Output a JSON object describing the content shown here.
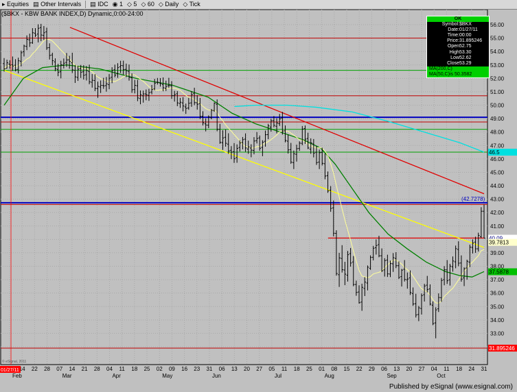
{
  "toolbar": {
    "items": [
      "Equities",
      "Other Intervals",
      "IDC",
      "1",
      "5",
      "60",
      "Daily",
      "Tick"
    ]
  },
  "title": "($BKX - KBW BANK INDEX,D) Dynamic,0:00-24:00",
  "indicator_labels": [
    {
      "text": "MA(200,C)",
      "color": "#00e0e0"
    },
    {
      "text": "MA(50,C)",
      "color": "#008000"
    },
    {
      "text": "MA(10,C)",
      "color": "#ffff80"
    }
  ],
  "legend": {
    "header": "OK",
    "rows": [
      {
        "k": "Symbol:",
        "v": "$BKX"
      },
      {
        "k": "Date:",
        "v": "01/27/11"
      },
      {
        "k": "Time:",
        "v": "00:00"
      },
      {
        "k": "Price:",
        "v": "31.895246"
      },
      {
        "k": "Open",
        "v": "52.75"
      },
      {
        "k": "High",
        "v": "53.30"
      },
      {
        "k": "Low",
        "v": "52.62"
      },
      {
        "k": "Close",
        "v": "53.29"
      }
    ],
    "ma_rows": [
      "MA(200,C)",
      "MA(50,C)is 50.3582"
    ]
  },
  "copyright": "© eSignal, 2011",
  "footer": "Published by eSignal (www.esignal.com)",
  "colors": {
    "background": "#c0c0c0",
    "candle": "#000000",
    "ma10": "#ffff99",
    "ma50": "#008000",
    "ma200": "#00e0e0",
    "trend_red": "#e00000",
    "trend_yellow": "#ffff00",
    "hline_blue": "#0000c0",
    "hline_green": "#00a000",
    "hline_red": "#c00000"
  },
  "chart_data": {
    "type": "candlestick",
    "ylim": [
      31.3,
      56.3
    ],
    "y_ticks": [
      "32.00",
      "33.00",
      "34.00",
      "35.00",
      "36.00",
      "37.00",
      "38.00",
      "39.00",
      "40.00",
      "41.00",
      "42.00",
      "43.00",
      "44.00",
      "45.00",
      "46.00",
      "47.00",
      "48.00",
      "49.00",
      "50.00",
      "51.00",
      "52.00",
      "53.00",
      "54.00",
      "55.00",
      "56.00"
    ],
    "x_tick_labels": [
      "07",
      "14",
      "22",
      "28",
      "07",
      "14",
      "21",
      "28",
      "04",
      "11",
      "18",
      "25",
      "02",
      "09",
      "16",
      "23",
      "31",
      "06",
      "13",
      "20",
      "27",
      "05",
      "11",
      "18",
      "25",
      "01",
      "08",
      "15",
      "22",
      "29",
      "06",
      "13",
      "20",
      "27",
      "04",
      "11",
      "18",
      "24",
      "31"
    ],
    "month_labels": [
      "Feb",
      "Mar",
      "Apr",
      "May",
      "Jun",
      "Jul",
      "Aug",
      "Sep",
      "Oct"
    ],
    "axis_box_labels": [
      {
        "text": "40.09",
        "value": 40.09,
        "bg": "#ffffff",
        "fg": "#000080"
      },
      {
        "text": "39.7813",
        "value": 39.78,
        "bg": "#ffffcc",
        "fg": "#000000"
      },
      {
        "text": "37.5878",
        "value": 37.59,
        "bg": "#00c000",
        "fg": "#000000"
      },
      {
        "text": "46.5",
        "value": 46.5,
        "bg": "#00e0e0",
        "fg": "#000000"
      },
      {
        "text": "31.895246",
        "value": 31.9,
        "bg": "#ff0000",
        "fg": "#ffffff"
      }
    ],
    "annotation": "(42.7278)",
    "annotation_value": 42.73,
    "date_box": "01/27/11",
    "horizontal_lines": [
      {
        "value": 55.0,
        "color": "hline_red"
      },
      {
        "value": 52.6,
        "color": "hline_green"
      },
      {
        "value": 50.7,
        "color": "hline_red"
      },
      {
        "value": 49.1,
        "color": "hline_blue"
      },
      {
        "value": 48.75,
        "color": "hline_red"
      },
      {
        "value": 48.2,
        "color": "hline_green"
      },
      {
        "value": 46.5,
        "color": "hline_green"
      },
      {
        "value": 42.73,
        "color": "hline_blue"
      },
      {
        "value": 42.6,
        "color": "hline_red"
      },
      {
        "value": 31.9,
        "color": "hline_red"
      }
    ],
    "red_segment": {
      "y_from": 40.1,
      "y_to": 40.1,
      "x_from": 135,
      "x_to": 200
    },
    "trend_red": {
      "x_from": 16,
      "y_from": 55.8,
      "x_to": 200,
      "y_to": 43.4
    },
    "trend_yellow": {
      "x_from": 0,
      "y_from": 52.6,
      "x_to": 200,
      "y_to": 39.4
    },
    "ma200": [
      [
        96,
        49.9
      ],
      [
        105,
        50.0
      ],
      [
        118,
        50.0
      ],
      [
        130,
        49.85
      ],
      [
        145,
        49.5
      ],
      [
        160,
        48.8
      ],
      [
        175,
        48.0
      ],
      [
        190,
        47.2
      ],
      [
        200,
        46.5
      ]
    ],
    "ma50": [
      [
        0,
        50.0
      ],
      [
        8,
        52.0
      ],
      [
        16,
        52.8
      ],
      [
        26,
        53.0
      ],
      [
        40,
        52.7
      ],
      [
        55,
        52.0
      ],
      [
        70,
        51.5
      ],
      [
        85,
        50.6
      ],
      [
        95,
        49.4
      ],
      [
        105,
        48.6
      ],
      [
        115,
        48.0
      ],
      [
        125,
        47.4
      ],
      [
        132,
        46.8
      ],
      [
        138,
        45.6
      ],
      [
        145,
        43.8
      ],
      [
        152,
        42.0
      ],
      [
        160,
        40.4
      ],
      [
        168,
        39.3
      ],
      [
        176,
        38.3
      ],
      [
        184,
        37.6
      ],
      [
        190,
        37.3
      ],
      [
        195,
        37.2
      ],
      [
        200,
        37.6
      ]
    ],
    "ohlc": [
      [
        53.1,
        53.51,
        52.51,
        52.71
      ],
      [
        52.75,
        53.39,
        52.73,
        53.16
      ],
      [
        53.06,
        53.35,
        52.72,
        52.98
      ],
      [
        53.0,
        53.63,
        52.56,
        52.92
      ],
      [
        52.98,
        53.43,
        52.52,
        52.64
      ],
      [
        52.67,
        53.54,
        52.37,
        53.31
      ],
      [
        53.28,
        54.07,
        52.89,
        53.91
      ],
      [
        53.98,
        54.51,
        53.63,
        54.41
      ],
      [
        54.38,
        55.2,
        54.1,
        54.9
      ],
      [
        54.87,
        55.33,
        54.34,
        54.64
      ],
      [
        54.66,
        55.74,
        54.57,
        55.4
      ],
      [
        55.36,
        55.74,
        55.08,
        55.22
      ],
      [
        55.3,
        56.03,
        54.68,
        55.73
      ],
      [
        55.78,
        56.06,
        54.77,
        55.23
      ],
      [
        55.2,
        55.9,
        54.85,
        55.4
      ],
      [
        55.47,
        55.78,
        54.12,
        54.27
      ],
      [
        54.29,
        54.61,
        53.4,
        53.71
      ],
      [
        53.74,
        53.91,
        52.97,
        53.32
      ],
      [
        53.23,
        53.49,
        52.53,
        52.72
      ],
      [
        52.67,
        53.08,
        52.16,
        52.46
      ],
      [
        52.49,
        53.31,
        52.0,
        53.01
      ],
      [
        52.98,
        53.48,
        52.74,
        53.13
      ],
      [
        53.19,
        53.89,
        52.86,
        53.37
      ],
      [
        53.38,
        53.68,
        52.72,
        53.27
      ],
      [
        53.16,
        53.91,
        52.4,
        52.63
      ],
      [
        52.6,
        53.0,
        51.66,
        52.11
      ],
      [
        52.07,
        52.93,
        51.81,
        52.68
      ],
      [
        52.74,
        53.0,
        52.03,
        52.46
      ],
      [
        52.49,
        52.98,
        51.91,
        52.23
      ],
      [
        52.27,
        52.92,
        51.84,
        52.58
      ],
      [
        52.51,
        53.02,
        51.56,
        51.74
      ],
      [
        51.71,
        52.32,
        51.31,
        51.86
      ],
      [
        51.84,
        52.31,
        51.05,
        51.25
      ],
      [
        51.24,
        51.76,
        50.55,
        51.4
      ],
      [
        51.36,
        51.84,
        50.91,
        51.48
      ],
      [
        51.47,
        52.04,
        51.22,
        51.44
      ],
      [
        51.46,
        52.1,
        51.01,
        51.59
      ],
      [
        51.53,
        52.32,
        51.19,
        52.01
      ],
      [
        52.08,
        52.83,
        51.64,
        52.58
      ],
      [
        52.64,
        53.02,
        52.08,
        52.24
      ],
      [
        52.34,
        53.13,
        52.04,
        52.8
      ],
      [
        52.86,
        53.31,
        52.4,
        52.96
      ],
      [
        52.94,
        53.32,
        52.28,
        52.65
      ],
      [
        52.67,
        53.1,
        52.09,
        52.57
      ],
      [
        52.52,
        53.03,
        51.83,
        52.08
      ],
      [
        52.05,
        52.37,
        50.92,
        51.15
      ],
      [
        51.17,
        51.88,
        50.88,
        51.48
      ],
      [
        51.45,
        51.89,
        50.3,
        50.54
      ],
      [
        50.5,
        51.1,
        50.07,
        50.78
      ],
      [
        50.7,
        51.09,
        50.19,
        50.84
      ],
      [
        50.84,
        51.17,
        50.37,
        50.78
      ],
      [
        50.73,
        51.22,
        50.32,
        50.93
      ],
      [
        50.98,
        51.51,
        50.81,
        51.18
      ],
      [
        51.21,
        51.96,
        51.12,
        51.64
      ],
      [
        51.7,
        52.03,
        51.54,
        51.71
      ],
      [
        51.66,
        52.02,
        51.39,
        51.61
      ],
      [
        51.54,
        52.07,
        51.04,
        51.3
      ],
      [
        51.25,
        51.83,
        51.06,
        51.4
      ],
      [
        51.46,
        52.04,
        51.29,
        51.47
      ],
      [
        51.45,
        51.79,
        50.47,
        50.71
      ],
      [
        50.71,
        51.07,
        50.27,
        50.79
      ],
      [
        50.85,
        51.05,
        49.93,
        50.17
      ],
      [
        50.13,
        50.54,
        49.8,
        50.22
      ],
      [
        50.17,
        50.6,
        49.54,
        49.94
      ],
      [
        49.87,
        50.12,
        49.35,
        49.76
      ],
      [
        49.79,
        50.55,
        49.66,
        50.15
      ],
      [
        50.17,
        51.05,
        49.88,
        50.79
      ],
      [
        50.86,
        51.3,
        50.0,
        50.19
      ],
      [
        50.18,
        50.75,
        49.67,
        50.07
      ],
      [
        50.12,
        50.54,
        48.97,
        49.16
      ],
      [
        49.17,
        49.55,
        48.49,
        48.69
      ],
      [
        48.61,
        49.02,
        48.05,
        48.52
      ],
      [
        48.51,
        49.24,
        48.29,
        49.13
      ],
      [
        49.07,
        49.72,
        48.95,
        49.61
      ],
      [
        49.61,
        50.21,
        49.51,
        50.15
      ],
      [
        50.07,
        50.43,
        48.06,
        48.21
      ],
      [
        48.2,
        48.61,
        47.12,
        47.23
      ],
      [
        47.21,
        48.13,
        46.67,
        47.56
      ],
      [
        47.61,
        48.19,
        46.91,
        47.16
      ],
      [
        47.1,
        47.91,
        46.38,
        46.6
      ],
      [
        46.64,
        46.95,
        45.98,
        46.5
      ],
      [
        46.54,
        47.18,
        45.7,
        46.01
      ],
      [
        46.1,
        47.08,
        45.71,
        46.78
      ],
      [
        46.85,
        47.38,
        46.55,
        47.19
      ],
      [
        47.22,
        47.63,
        46.71,
        47.43
      ],
      [
        47.47,
        47.9,
        46.53,
        46.81
      ],
      [
        46.73,
        47.36,
        46.38,
        46.89
      ],
      [
        46.81,
        47.09,
        46.12,
        46.65
      ],
      [
        46.63,
        47.62,
        46.34,
        47.33
      ],
      [
        47.36,
        48.0,
        47.15,
        47.52
      ],
      [
        47.56,
        47.74,
        46.61,
        46.79
      ],
      [
        46.85,
        47.39,
        46.2,
        47.24
      ],
      [
        47.31,
        48.11,
        46.91,
        47.8
      ],
      [
        47.81,
        48.61,
        47.47,
        48.46
      ],
      [
        48.37,
        48.99,
        48.03,
        48.84
      ],
      [
        48.85,
        49.19,
        48.35,
        48.5
      ],
      [
        48.43,
        49.03,
        47.9,
        48.67
      ],
      [
        48.62,
        49.35,
        48.45,
        48.98
      ],
      [
        49.04,
        49.5,
        47.81,
        48.08
      ],
      [
        48.09,
        48.49,
        47.23,
        47.37
      ],
      [
        47.32,
        47.81,
        46.4,
        46.67
      ],
      [
        46.69,
        47.19,
        45.63,
        45.76
      ],
      [
        45.72,
        46.62,
        45.24,
        46.38
      ],
      [
        46.34,
        47.06,
        45.8,
        46.76
      ],
      [
        46.78,
        47.31,
        46.6,
        47.17
      ],
      [
        47.16,
        48.45,
        47.02,
        48.22
      ],
      [
        48.26,
        48.49,
        47.12,
        47.47
      ],
      [
        47.52,
        47.95,
        46.73,
        46.81
      ],
      [
        46.72,
        47.53,
        46.38,
        47.19
      ],
      [
        47.11,
        47.48,
        46.11,
        46.42
      ],
      [
        46.49,
        46.97,
        45.55,
        45.72
      ],
      [
        45.76,
        46.69,
        45.24,
        46.46
      ],
      [
        46.48,
        46.83,
        45.51,
        45.67
      ],
      [
        45.64,
        46.41,
        44.48,
        44.72
      ],
      [
        44.75,
        45.06,
        43.47,
        43.61
      ],
      [
        43.67,
        43.97,
        42.06,
        42.31
      ],
      [
        42.35,
        42.9,
        40.23,
        40.46
      ],
      [
        40.45,
        40.68,
        37.3,
        37.46
      ],
      [
        37.37,
        39.0,
        36.46,
        38.62
      ],
      [
        38.58,
        39.57,
        37.53,
        37.74
      ],
      [
        37.72,
        38.33,
        36.59,
        37.41
      ],
      [
        37.33,
        39.14,
        36.86,
        38.86
      ],
      [
        38.94,
        39.36,
        37.97,
        38.24
      ],
      [
        38.32,
        38.76,
        36.51,
        36.64
      ],
      [
        36.64,
        36.93,
        35.8,
        36.05
      ],
      [
        36.08,
        36.58,
        35.22,
        35.28
      ],
      [
        35.33,
        36.7,
        34.68,
        36.43
      ],
      [
        36.34,
        37.19,
        35.78,
        36.82
      ],
      [
        36.75,
        38.06,
        36.2,
        37.93
      ],
      [
        37.85,
        38.81,
        37.73,
        38.66
      ],
      [
        38.67,
        39.52,
        38.44,
        39.34
      ],
      [
        39.38,
        40.0,
        38.87,
        39.54
      ],
      [
        39.61,
        40.27,
        38.67,
        38.78
      ],
      [
        38.78,
        39.33,
        37.57,
        37.67
      ],
      [
        37.73,
        38.6,
        37.23,
        38.42
      ],
      [
        38.46,
        38.86,
        37.2,
        37.43
      ],
      [
        37.42,
        38.42,
        37.19,
        38.2
      ],
      [
        38.18,
        38.98,
        37.58,
        38.64
      ],
      [
        38.58,
        39.05,
        37.86,
        38.04
      ],
      [
        38.04,
        38.36,
        37.05,
        37.17
      ],
      [
        37.23,
        37.8,
        36.49,
        37.71
      ],
      [
        37.77,
        38.46,
        36.86,
        37.02
      ],
      [
        36.99,
        37.53,
        36.33,
        37.05
      ],
      [
        37.13,
        37.69,
        35.86,
        36.04
      ],
      [
        35.97,
        36.42,
        35.05,
        35.19
      ],
      [
        35.21,
        35.95,
        34.18,
        34.37
      ],
      [
        34.41,
        35.04,
        33.91,
        34.9
      ],
      [
        34.85,
        35.97,
        34.4,
        35.81
      ],
      [
        35.88,
        36.69,
        35.37,
        36.53
      ],
      [
        36.59,
        37.28,
        36.05,
        36.27
      ],
      [
        36.31,
        36.65,
        35.08,
        35.18
      ],
      [
        35.1,
        35.38,
        33.61,
        33.73
      ],
      [
        33.78,
        34.94,
        32.63,
        34.75
      ],
      [
        34.83,
        35.98,
        34.59,
        35.67
      ],
      [
        35.66,
        37.13,
        35.35,
        36.94
      ],
      [
        37.0,
        38.01,
        36.58,
        37.74
      ],
      [
        37.73,
        38.46,
        36.68,
        36.92
      ],
      [
        36.99,
        38.18,
        36.56,
        38.01
      ],
      [
        37.96,
        38.73,
        37.6,
        38.39
      ],
      [
        38.33,
        39.54,
        37.85,
        39.31
      ],
      [
        39.25,
        39.86,
        38.0,
        38.23
      ],
      [
        38.24,
        38.81,
        36.85,
        37.04
      ],
      [
        37.13,
        37.92,
        36.52,
        37.81
      ],
      [
        37.87,
        38.49,
        37.0,
        38.37
      ],
      [
        38.31,
        39.61,
        37.94,
        39.42
      ],
      [
        39.4,
        40.0,
        38.95,
        39.73
      ],
      [
        39.8,
        40.2,
        39.0,
        39.3
      ],
      [
        39.3,
        40.5,
        39.1,
        40.3
      ],
      [
        40.2,
        42.4,
        40.1,
        42.1
      ],
      [
        42.1,
        42.6,
        40.1,
        40.09
      ]
    ]
  }
}
